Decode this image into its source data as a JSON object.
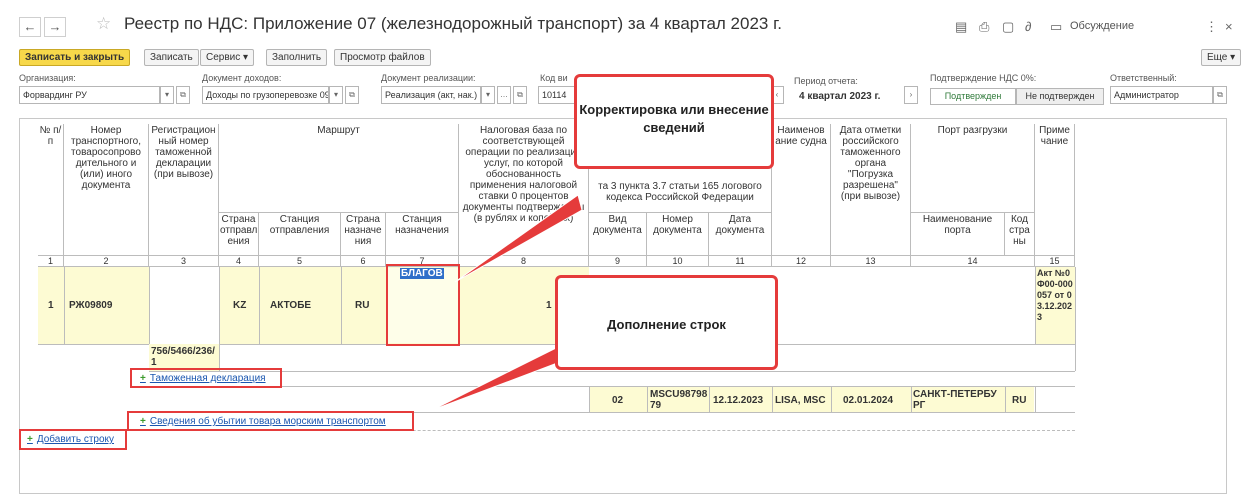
{
  "window": {
    "title": "Реестр по НДС: Приложение 07 (железнодорожный транспорт) за 4 квартал 2023 г.",
    "discussion": "Обсуждение"
  },
  "toolbar": {
    "save_close": "Записать и закрыть",
    "save": "Записать",
    "service": "Сервис",
    "fill": "Заполнить",
    "view_files": "Просмотр файлов",
    "more": "Еще"
  },
  "form": {
    "org_label": "Организация:",
    "org_value": "Форвардинг РУ",
    "income_doc_label": "Документ доходов:",
    "income_doc_value": "Доходы по грузоперевозке 09",
    "sale_doc_label": "Документ реализации:",
    "sale_doc_value": "Реализация (акт, нак.)",
    "code_label": "Код ви",
    "code_value": "10114",
    "period_label": "Период отчета:",
    "period_value": "4 квартал 2023 г.",
    "vat_label": "Подтверждение НДС 0%:",
    "confirmed": "Подтвержден",
    "not_confirmed": "Не подтвержден",
    "responsible_label": "Ответственный:",
    "responsible_value": "Администратор"
  },
  "table": {
    "headers": {
      "num": "№ п/п",
      "doc_number": "Номер транспортного, товаросопрово дительного и (или) иного документа",
      "reg_number": "Регистрацион ный номер таможенной декларации (при вывозе)",
      "route": "Маршрут",
      "tax_base": "Налоговая база по соответствующей операции по реализации услуг, по которой обоснованность применения налоговой ставки 0 процентов документы подтверждены (в рублях и копейках)",
      "docs_group": "та 3 пункта 3.7 статьи 165 логового кодекса Российской Федерации",
      "vessel": "Наименов ание судна",
      "mark_date": "Дата отметки российского таможенного органа \"Погрузка разрешена\" (при вывозе)",
      "port": "Порт разгрузки",
      "note": "Приме чание",
      "country_from": "Страна отправл ения",
      "station_from": "Станция отправления",
      "country_to": "Страна назначе ния",
      "station_to": "Станция назначения",
      "doc_type": "Вид документа",
      "doc_no": "Номер документа",
      "doc_date": "Дата документа",
      "port_name": "Наименование порта",
      "country_code": "Код стра ны"
    },
    "col_numbers": [
      "1",
      "2",
      "3",
      "4",
      "5",
      "6",
      "7",
      "8",
      "9",
      "10",
      "11",
      "12",
      "13",
      "14",
      "15"
    ],
    "row": {
      "num": "1",
      "doc_number": "РЖ09809",
      "country_from": "KZ",
      "station_from": "АКТОБЕ",
      "country_to": "RU",
      "station_to": "БЛАГОВ",
      "tax_base": "1",
      "note": "Акт №0Ф00-000057 от 03.12.2023",
      "customs_decl": "756/5466/236/1",
      "doc_type": "02",
      "doc_no": "MSCU9879879",
      "doc_date": "12.12.2023",
      "vessel": "LISA, MSC",
      "mark_date": "02.01.2024",
      "port_name": "САНКТ-ПЕТЕРБУРГ",
      "country_code": "RU"
    },
    "links": {
      "customs": "Таможенная декларация",
      "sea": "Сведения об убытии товара морским транспортом",
      "add_row": "Добавить строку"
    }
  },
  "callouts": {
    "correction": "Корректировка или внесение сведений",
    "addition": "Дополнение строк"
  },
  "colors": {
    "accent": "#f7d84a",
    "highlight": "#e53b3b",
    "link": "#1a56b0",
    "row_bg": "#fdfbd3"
  }
}
